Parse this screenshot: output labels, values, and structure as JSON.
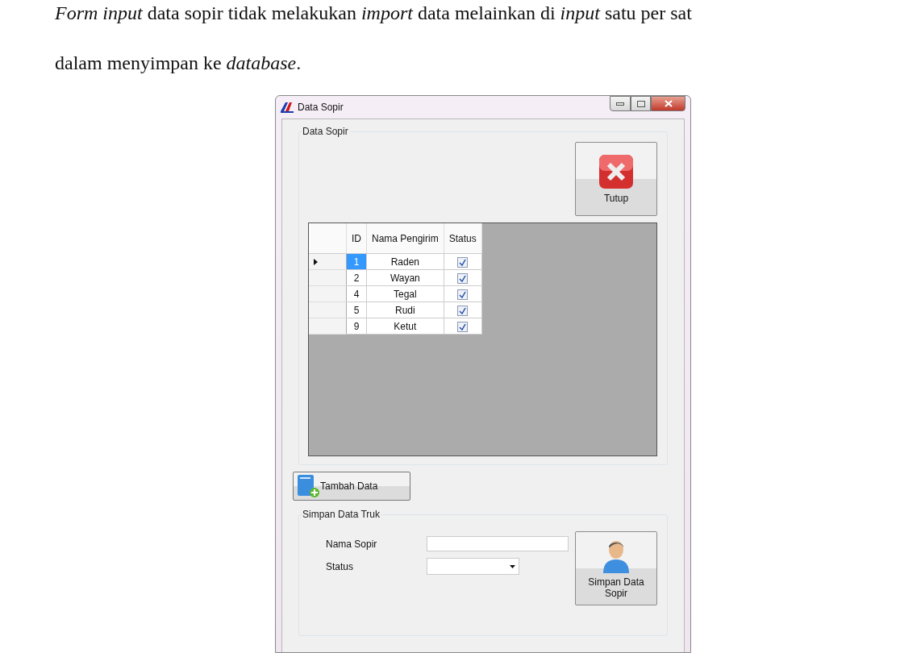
{
  "document": {
    "lines": [
      "*Form input* data sopir tidak melakukan *import* data melainkan di *input* satu per sat",
      "dalam menyimpan ke *database*."
    ]
  },
  "window": {
    "title": "Data Sopir"
  },
  "group_data": {
    "title": "Data Sopir",
    "close_button": "Tutup",
    "table": {
      "columns": [
        "ID",
        "Nama Pengirim",
        "Status"
      ],
      "rows": [
        {
          "id": "1",
          "name": "Raden",
          "checked": true,
          "selected": true
        },
        {
          "id": "2",
          "name": "Wayan",
          "checked": true,
          "selected": false
        },
        {
          "id": "4",
          "name": "Tegal",
          "checked": true,
          "selected": false
        },
        {
          "id": "5",
          "name": "Rudi",
          "checked": true,
          "selected": false
        },
        {
          "id": "9",
          "name": "Ketut",
          "checked": true,
          "selected": false
        }
      ]
    }
  },
  "add_button": "Tambah Data",
  "group_save": {
    "title": "Simpan Data Truk",
    "fields": [
      {
        "kind": "text",
        "label": "Nama Sopir"
      },
      {
        "kind": "select",
        "label": "Status"
      }
    ],
    "save_button": "Simpan Data Sopir"
  }
}
